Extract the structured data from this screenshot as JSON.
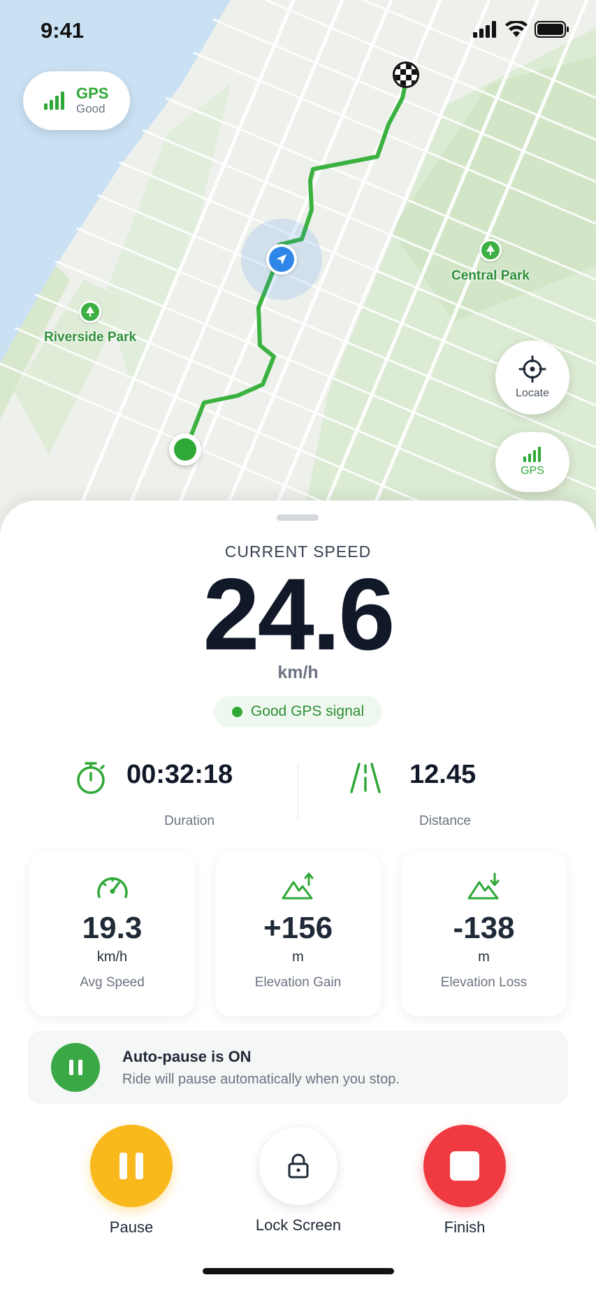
{
  "status_bar": {
    "time": "9:41"
  },
  "map": {
    "gps_pill": {
      "title": "GPS",
      "status": "Good"
    },
    "pois": [
      {
        "label": "Central Park"
      },
      {
        "label": "Riverside Park"
      }
    ],
    "locate_button": {
      "label": "Locate"
    },
    "gps_button": {
      "label": "GPS"
    }
  },
  "speed": {
    "label": "CURRENT SPEED",
    "value": "24.6",
    "unit": "km/h",
    "signal": "Good GPS signal"
  },
  "stats": {
    "duration": {
      "value": "00:32:18",
      "label": "Duration"
    },
    "distance": {
      "value": "12.45",
      "label": "Distance"
    }
  },
  "cards": [
    {
      "icon": "speedometer-icon",
      "value": "19.3",
      "unit": "km/h",
      "label": "Avg Speed"
    },
    {
      "icon": "elevation-gain-icon",
      "value": "+156",
      "unit": "m",
      "label": "Elevation Gain"
    },
    {
      "icon": "elevation-loss-icon",
      "value": "-138",
      "unit": "m",
      "label": "Elevation Loss"
    }
  ],
  "autopause": {
    "title": "Auto-pause is ON",
    "description": "Ride will pause automatically when you stop."
  },
  "controls": {
    "pause": "Pause",
    "lock": "Lock Screen",
    "finish": "Finish"
  },
  "colors": {
    "accent_green": "#2ea836",
    "pause_yellow": "#f9b81c",
    "finish_red": "#ee3a40",
    "location_blue": "#2e86e8"
  }
}
